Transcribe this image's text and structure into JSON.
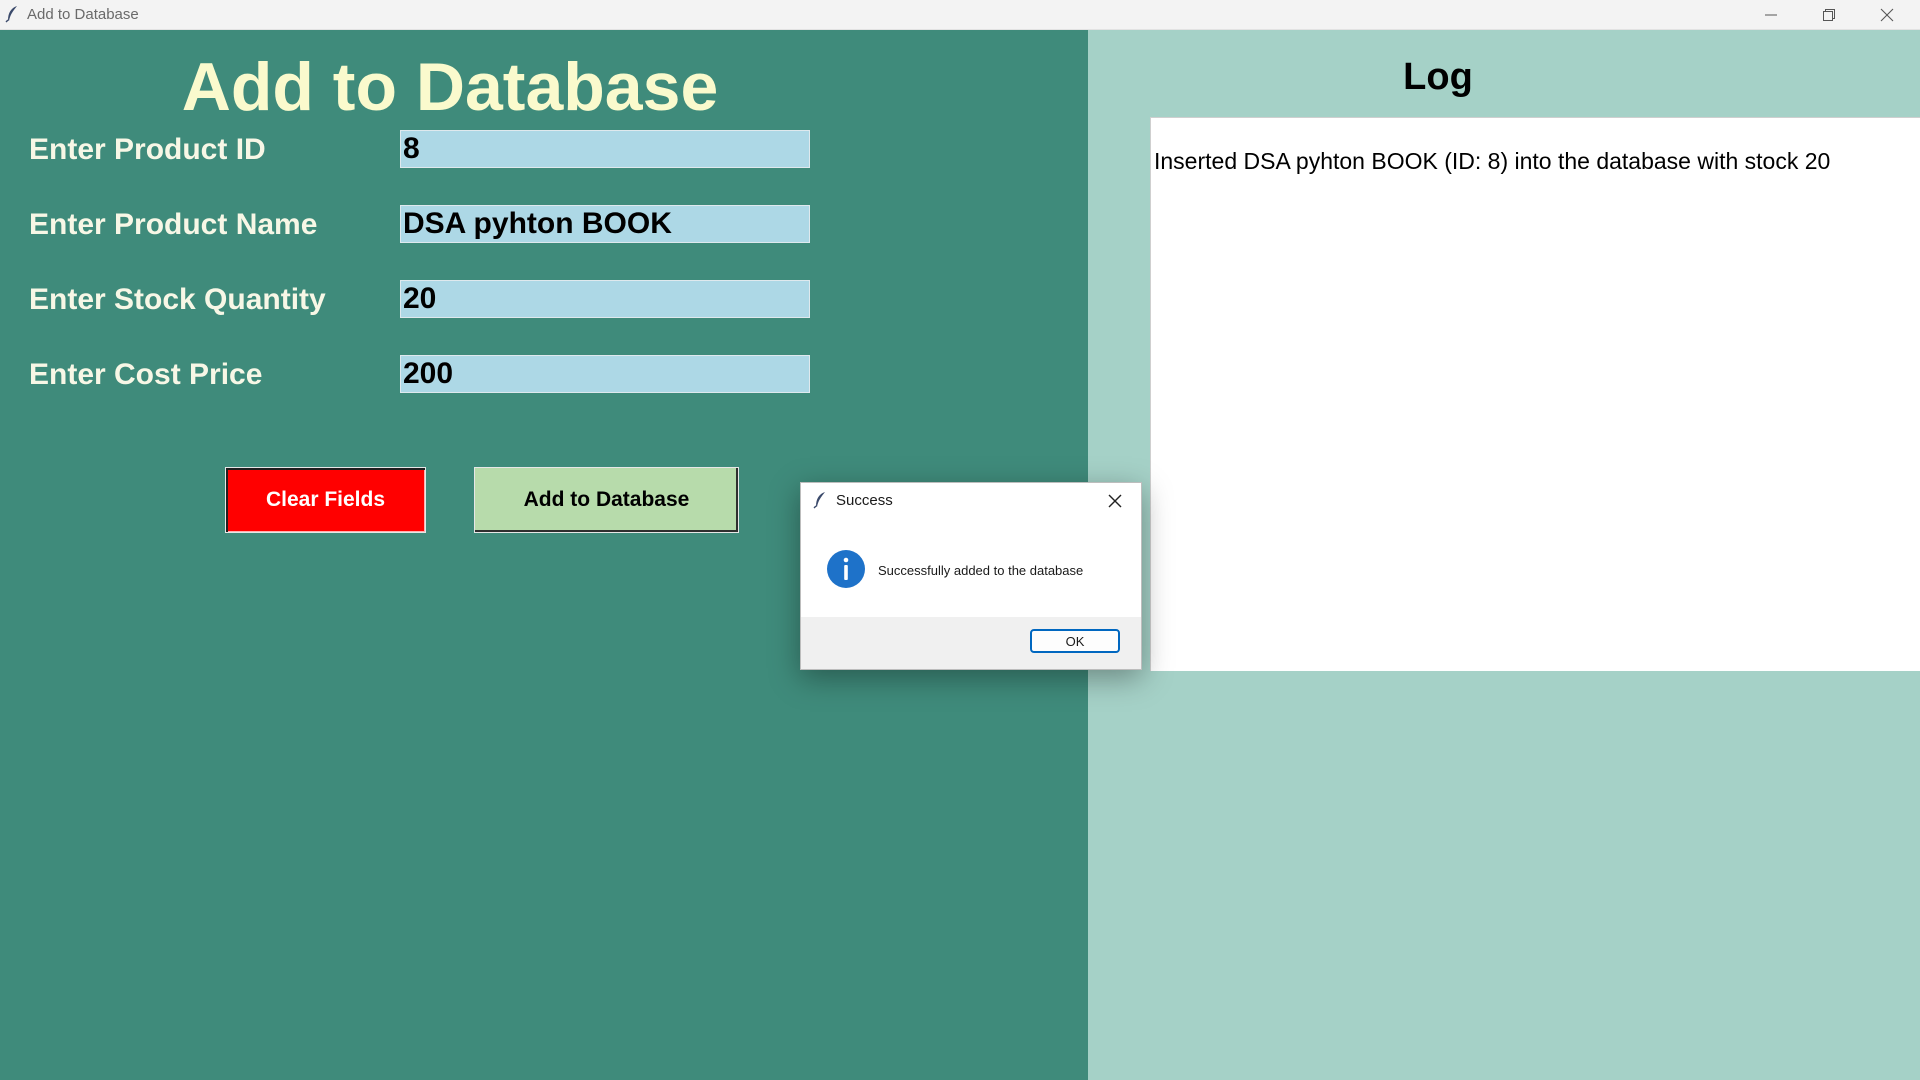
{
  "window": {
    "title": "Add to Database",
    "icons": {
      "app": "feather-icon",
      "minimize": "minimize-icon",
      "maximize": "restore-icon",
      "close": "close-icon"
    }
  },
  "form": {
    "heading": "Add to Database",
    "fields": [
      {
        "label": "Enter Product ID",
        "value": "8"
      },
      {
        "label": "Enter Product Name",
        "value": "DSA pyhton BOOK"
      },
      {
        "label": "Enter Stock Quantity",
        "value": "20"
      },
      {
        "label": "Enter Cost Price",
        "value": "200"
      }
    ],
    "clear_button": "Clear Fields",
    "add_button": "Add to Database"
  },
  "log": {
    "title": "Log",
    "entries": [
      "Inserted DSA pyhton BOOK (ID: 8) into the database with stock 20"
    ]
  },
  "dialog": {
    "title": "Success",
    "message": "Successfully added to the database",
    "ok_button": "OK",
    "icon": "info-icon"
  },
  "colors": {
    "left_bg": "#3f8b7b",
    "right_bg": "#a5d1c7",
    "heading": "#fafacd",
    "input_bg": "#add8e6",
    "clear_button": "#ff0000",
    "add_button": "#b7dbab",
    "info_icon": "#1e72c9"
  }
}
